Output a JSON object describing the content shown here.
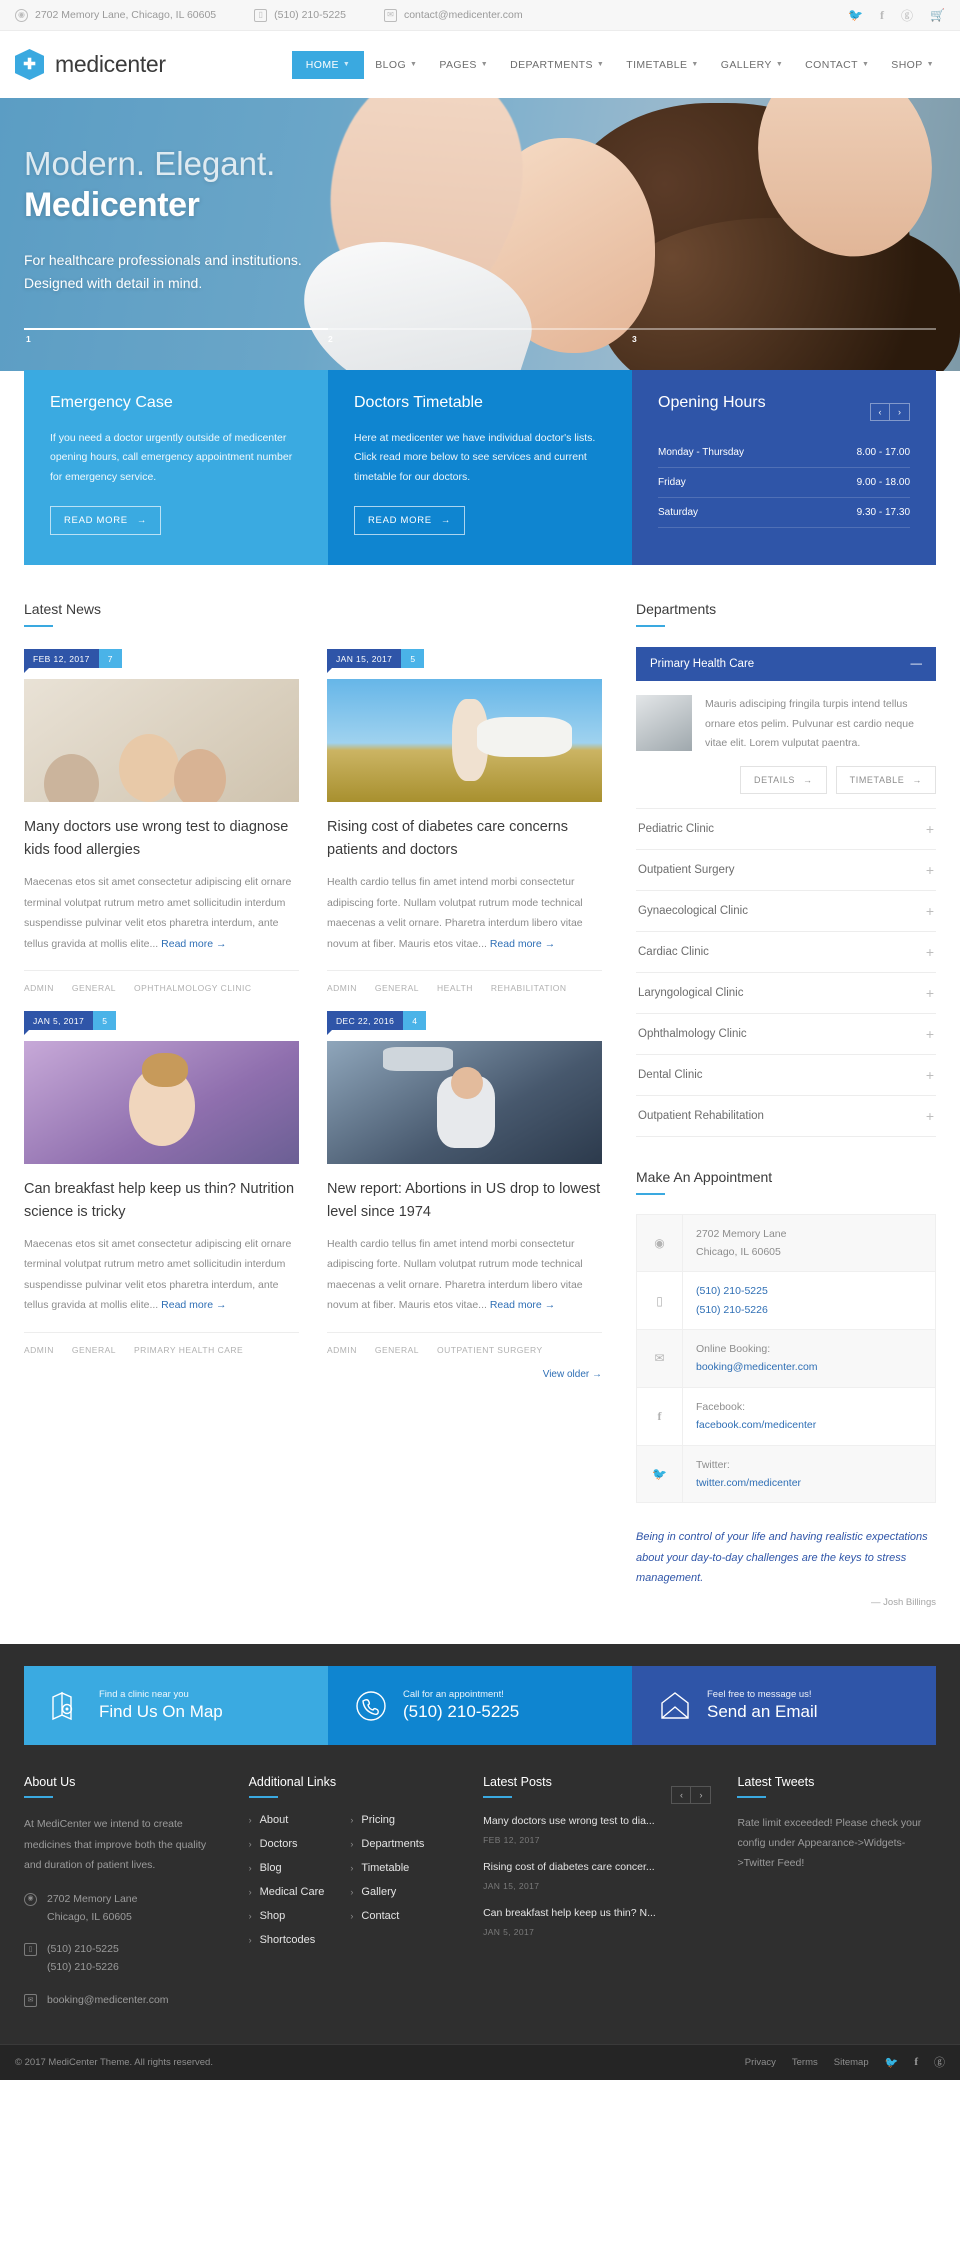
{
  "topbar": {
    "address": "2702 Memory Lane, Chicago, IL 60605",
    "phone": "(510) 210-5225",
    "email": "contact@medicenter.com",
    "social": [
      "twitter-icon",
      "facebook-icon",
      "google-plus-icon",
      "cart-icon"
    ]
  },
  "header": {
    "brand": "medicenter",
    "nav": [
      {
        "label": "HOME",
        "caret": true,
        "active": true
      },
      {
        "label": "BLOG",
        "caret": true,
        "active": false
      },
      {
        "label": "PAGES",
        "caret": true,
        "active": false
      },
      {
        "label": "DEPARTMENTS",
        "caret": true,
        "active": false
      },
      {
        "label": "TIMETABLE",
        "caret": true,
        "active": false
      },
      {
        "label": "GALLERY",
        "caret": true,
        "active": false
      },
      {
        "label": "CONTACT",
        "caret": true,
        "active": false
      },
      {
        "label": "SHOP",
        "caret": true,
        "active": false
      }
    ]
  },
  "hero": {
    "subtitle": "Modern. Elegant.",
    "title": "Medicenter",
    "desc_line1": "For healthcare professionals and institutions.",
    "desc_line2": "Designed with detail in mind.",
    "slides": [
      "1",
      "2",
      "3"
    ]
  },
  "features": [
    {
      "title": "Emergency Case",
      "text": "If you need a doctor urgently outside of medicenter opening hours, call emergency appointment number for emergency service.",
      "button": "READ MORE"
    },
    {
      "title": "Doctors Timetable",
      "text": "Here at medicenter we have individual doctor's lists. Click read more below to see services and current timetable for our doctors.",
      "button": "READ MORE"
    }
  ],
  "opening_hours": {
    "title": "Opening Hours",
    "rows": [
      {
        "day": "Monday - Thursday",
        "time": "8.00 - 17.00"
      },
      {
        "day": "Friday",
        "time": "9.00 - 18.00"
      },
      {
        "day": "Saturday",
        "time": "9.30 - 17.30"
      }
    ]
  },
  "latest_news": {
    "title": "Latest News",
    "view_older": "View older",
    "posts": [
      {
        "date": "FEB 12, 2017",
        "comments": "7",
        "title": "Many doctors use wrong test to diagnose kids food allergies",
        "excerpt": "Maecenas etos sit amet consectetur adipiscing elit ornare terminal volutpat rutrum metro amet sollicitudin interdum suspendisse pulvinar velit etos pharetra interdum, ante tellus gravida at mollis elite...",
        "read_more": "Read more",
        "meta": [
          "ADMIN",
          "GENERAL",
          "OPHTHALMOLOGY CLINIC"
        ]
      },
      {
        "date": "JAN 15, 2017",
        "comments": "5",
        "title": "Rising cost of diabetes care concerns patients and doctors",
        "excerpt": "Health cardio tellus fin amet intend morbi consectetur adipiscing forte. Nullam volutpat rutrum mode technical maecenas a velit ornare. Pharetra interdum libero vitae novum at fiber. Mauris etos vitae...",
        "read_more": "Read more",
        "meta": [
          "ADMIN",
          "GENERAL",
          "HEALTH",
          "REHABILITATION"
        ]
      },
      {
        "date": "JAN 5, 2017",
        "comments": "5",
        "title": "Can breakfast help keep us thin? Nutrition science is tricky",
        "excerpt": "Maecenas etos sit amet consectetur adipiscing elit ornare terminal volutpat rutrum metro amet sollicitudin interdum suspendisse pulvinar velit etos pharetra interdum, ante tellus gravida at mollis elite...",
        "read_more": "Read more",
        "meta": [
          "ADMIN",
          "GENERAL",
          "PRIMARY HEALTH CARE"
        ]
      },
      {
        "date": "DEC 22, 2016",
        "comments": "4",
        "title": "New report: Abortions in US drop to lowest level since 1974",
        "excerpt": "Health cardio tellus fin amet intend morbi consectetur adipiscing forte. Nullam volutpat rutrum mode technical maecenas a velit ornare. Pharetra interdum libero vitae novum at fiber. Mauris etos vitae...",
        "read_more": "Read more",
        "meta": [
          "ADMIN",
          "GENERAL",
          "OUTPATIENT SURGERY"
        ]
      }
    ]
  },
  "departments": {
    "title": "Departments",
    "active": {
      "name": "Primary Health Care",
      "text": "Mauris adisciping fringila turpis intend tellus ornare etos pelim. Pulvunar est cardio neque vitae elit. Lorem vulputat paentra.",
      "btn_details": "DETAILS",
      "btn_timetable": "TIMETABLE"
    },
    "items": [
      "Pediatric Clinic",
      "Outpatient Surgery",
      "Gynaecological Clinic",
      "Cardiac Clinic",
      "Laryngological Clinic",
      "Ophthalmology Clinic",
      "Dental Clinic",
      "Outpatient Rehabilitation"
    ]
  },
  "appointment": {
    "title": "Make An Appointment",
    "rows": [
      {
        "icon": "location-pin-icon",
        "line1": "2702 Memory Lane",
        "line2": "Chicago, IL 60605",
        "link1": "",
        "link2": ""
      },
      {
        "icon": "phone-icon",
        "line1": "",
        "line2": "",
        "link1": "(510) 210-5225",
        "link2": "(510) 210-5226"
      },
      {
        "icon": "envelope-icon",
        "line1": "Online Booking:",
        "line2": "",
        "link1": "booking@medicenter.com",
        "link2": ""
      },
      {
        "icon": "facebook-icon",
        "line1": "Facebook:",
        "line2": "",
        "link1": "facebook.com/medicenter",
        "link2": ""
      },
      {
        "icon": "twitter-icon",
        "line1": "Twitter:",
        "line2": "",
        "link1": "twitter.com/medicenter",
        "link2": ""
      }
    ],
    "quote": "Being in control of your life and having realistic expectations about your day-to-day challenges are the keys to stress management.",
    "quote_author": "— Josh Billings"
  },
  "cta": [
    {
      "icon": "map-icon",
      "small": "Find a clinic near you",
      "big": "Find Us On Map"
    },
    {
      "icon": "phone-handset-icon",
      "small": "Call for an appointment!",
      "big": "(510) 210-5225"
    },
    {
      "icon": "envelope-open-icon",
      "small": "Feel free to message us!",
      "big": "Send an Email"
    }
  ],
  "footer": {
    "about": {
      "title": "About Us",
      "text": "At MediCenter we intend to create medicines that improve both the quality and duration of patient lives.",
      "address_l1": "2702 Memory Lane",
      "address_l2": "Chicago, IL 60605",
      "phone1": "(510) 210-5225",
      "phone2": "(510) 210-5226",
      "email": "booking@medicenter.com"
    },
    "links": {
      "title": "Additional Links",
      "col1": [
        "About",
        "Doctors",
        "Blog",
        "Medical Care",
        "Shop",
        "Shortcodes"
      ],
      "col2": [
        "Pricing",
        "Departments",
        "Timetable",
        "Gallery",
        "Contact"
      ]
    },
    "latest_posts": {
      "title": "Latest Posts",
      "items": [
        {
          "title": "Many doctors use wrong test to dia...",
          "date": "FEB 12, 2017"
        },
        {
          "title": "Rising cost of diabetes care concer...",
          "date": "JAN 15, 2017"
        },
        {
          "title": "Can breakfast help keep us thin? N...",
          "date": "JAN 5, 2017"
        }
      ]
    },
    "tweets": {
      "title": "Latest Tweets",
      "text": "Rate limit exceeded! Please check your config under Appearance->Widgets->Twitter Feed!"
    }
  },
  "bottombar": {
    "copyright": "© 2017 MediCenter Theme. All rights reserved.",
    "links": [
      "Privacy",
      "Terms",
      "Sitemap"
    ],
    "social": [
      "twitter-icon",
      "facebook-icon",
      "google-plus-icon"
    ]
  }
}
